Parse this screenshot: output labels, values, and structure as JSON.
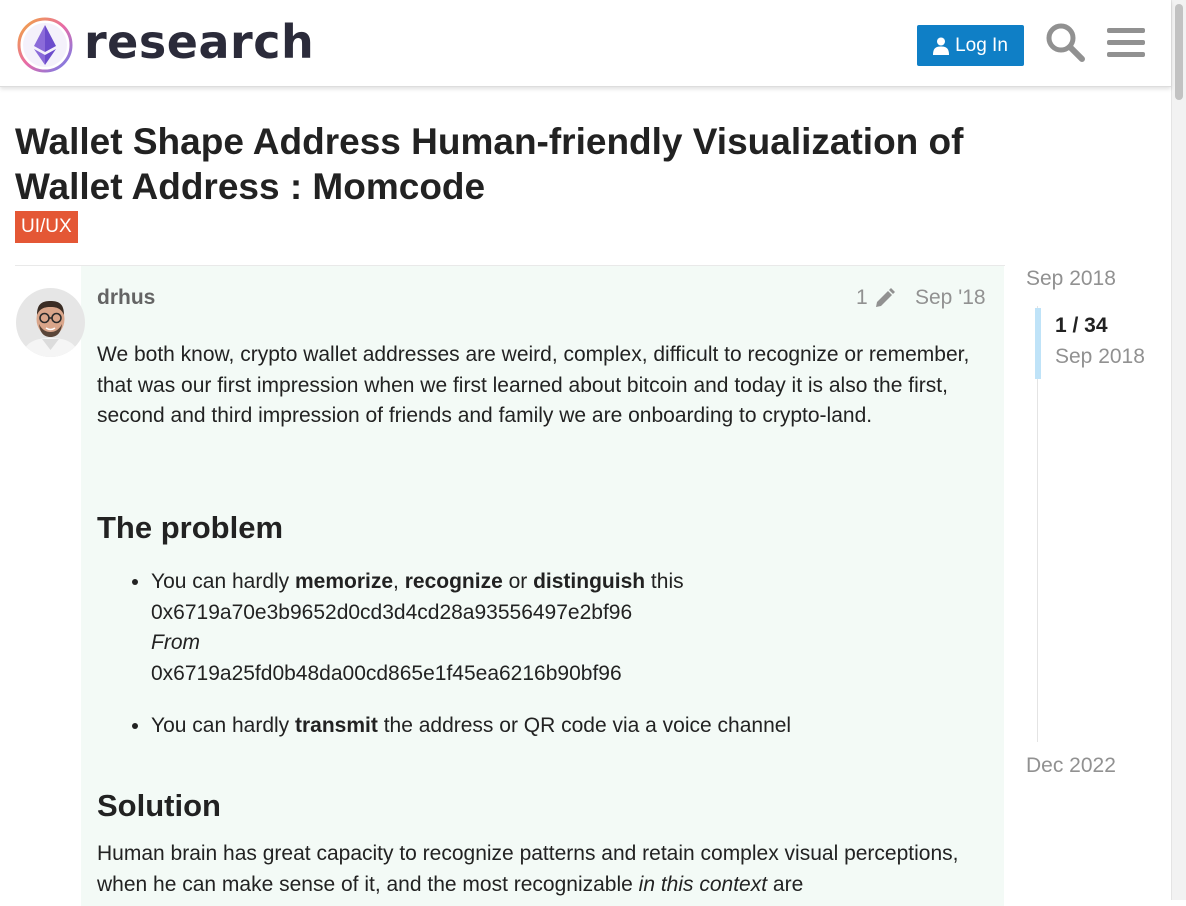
{
  "header": {
    "site_name": "research",
    "login_label": "Log In",
    "icons": [
      "logo-icon",
      "user-icon",
      "search-icon",
      "hamburger-menu-icon"
    ],
    "login_color": "#0f7fc6"
  },
  "topic": {
    "title": "Wallet Shape Address Human-friendly Visualization of Wallet Address : Momcode",
    "category": "UI/UX",
    "category_color": "#e45735"
  },
  "post": {
    "username": "drhus",
    "edit_count": "1",
    "date": "Sep '18",
    "intro": "We both know, crypto wallet addresses are weird, complex, difficult to recognize or remember, that was our first impression when we first learned about bitcoin and today it is also the first, second and third impression of friends and family we are onboarding to crypto-land.",
    "problem_heading": "The problem",
    "bullet1": {
      "t1": "You can hardly ",
      "b1": "memorize",
      "t2": ", ",
      "b2": "recognize",
      "t3": " or ",
      "b3": "distinguish",
      "t4": " this",
      "address1": "0x6719a70e3b9652d0cd3d4cd28a93556497e2bf96",
      "from": "From",
      "address2": "0x6719a25fd0b48da00cd865e1f45ea6216b90bf96"
    },
    "bullet2": {
      "t1": "You can hardly ",
      "b1": "transmit",
      "t2": " the address or QR code via a voice channel"
    },
    "solution_heading": "Solution",
    "solution": {
      "t1": "Human brain has great capacity to recognize patterns and retain complex visual perceptions, when he can make sense of it, and the most recognizable ",
      "em": "in this context",
      "t2": " are"
    }
  },
  "timeline": {
    "start": "Sep 2018",
    "position": "1 / 34",
    "position_date": "Sep 2018",
    "end": "Dec 2022"
  }
}
